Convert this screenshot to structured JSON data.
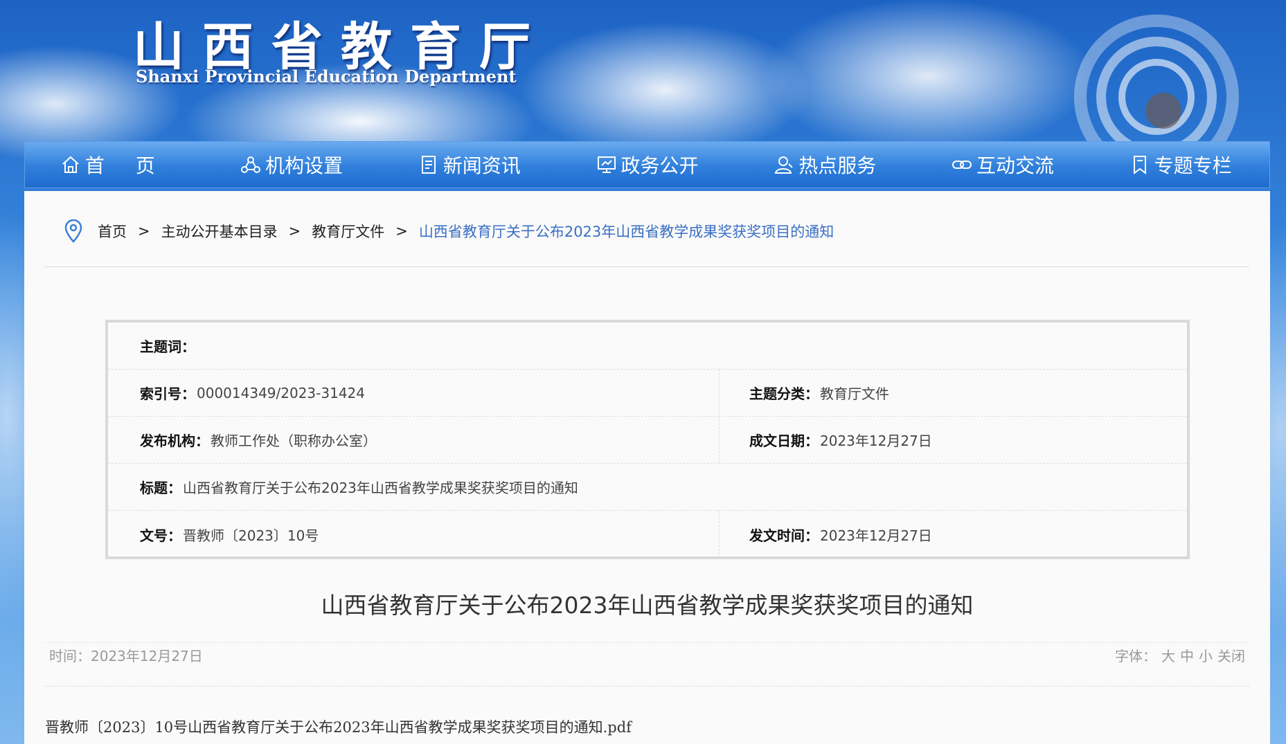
{
  "header": {
    "title": "山西省教育厅",
    "subtitle": "Shanxi Provincial Education Department"
  },
  "nav": [
    {
      "label": "首 页",
      "icon": "home-icon"
    },
    {
      "label": "机构设置",
      "icon": "org-icon"
    },
    {
      "label": "新闻资讯",
      "icon": "news-icon"
    },
    {
      "label": "政务公开",
      "icon": "gov-icon"
    },
    {
      "label": "热点服务",
      "icon": "service-icon"
    },
    {
      "label": "互动交流",
      "icon": "link-icon"
    },
    {
      "label": "专题专栏",
      "icon": "bookmark-icon"
    }
  ],
  "breadcrumb": {
    "items": [
      "首页",
      "主动公开基本目录",
      "教育厅文件"
    ],
    "current": "山西省教育厅关于公布2023年山西省教学成果奖获奖项目的通知",
    "separator": ">"
  },
  "info": {
    "keywords_label": "主题词：",
    "keywords_value": "",
    "index_label": "索引号：",
    "index_value": "000014349/2023-31424",
    "category_label": "主题分类：",
    "category_value": "教育厅文件",
    "publisher_label": "发布机构：",
    "publisher_value": "教师工作处（职称办公室）",
    "date_label": "成文日期：",
    "date_value": "2023年12月27日",
    "title_label": "标题：",
    "title_value": "山西省教育厅关于公布2023年山西省教学成果奖获奖项目的通知",
    "docno_label": "文号：",
    "docno_value": "晋教师〔2023〕10号",
    "issue_label": "发文时间：",
    "issue_value": "2023年12月27日"
  },
  "article": {
    "title": "山西省教育厅关于公布2023年山西省教学成果奖获奖项目的通知",
    "time": "时间：2023年12月27日",
    "font_label": "字体：",
    "font_large": "大",
    "font_medium": "中",
    "font_small": "小",
    "font_close": "关闭",
    "attachment": "晋教师〔2023〕10号山西省教育厅关于公布2023年山西省教学成果奖获奖项目的通知.pdf"
  },
  "colors": {
    "nav_blue": "#2f7fdb",
    "link_blue": "#3a6fc4"
  }
}
